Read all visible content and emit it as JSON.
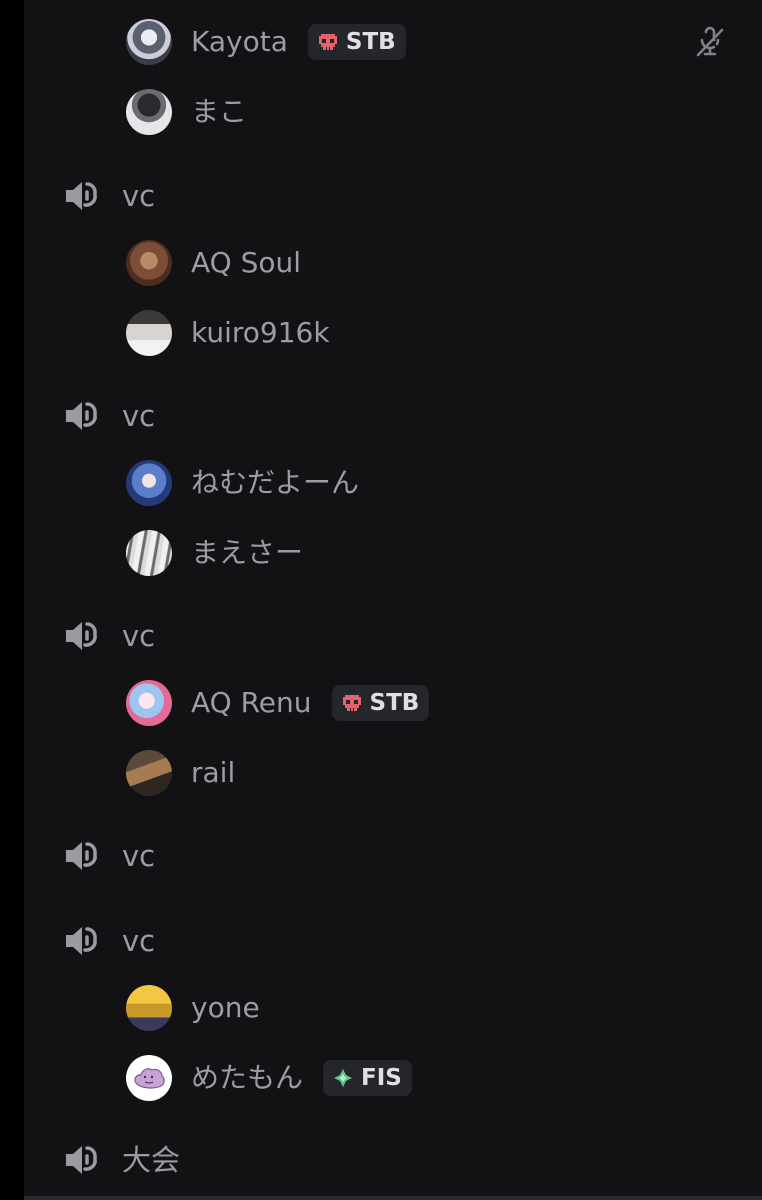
{
  "colors": {
    "background": "#121214",
    "text": "#9b9ca4",
    "tag_bg": "#25262b",
    "tag_text": "#dfe0e5",
    "stb_icon": "#e5626c",
    "fis_icon": "#5fc38a"
  },
  "top_members": [
    {
      "name": "Kayota",
      "tag": "STB",
      "tag_icon": "skull-icon",
      "muted": true
    },
    {
      "name": "まこ"
    }
  ],
  "channels": [
    {
      "name": "vc",
      "icon": "speaker-icon",
      "members": [
        {
          "name": "AQ Soul"
        },
        {
          "name": "kuiro916k"
        }
      ]
    },
    {
      "name": "vc",
      "icon": "speaker-icon",
      "members": [
        {
          "name": "ねむだよーん"
        },
        {
          "name": "まえさー"
        }
      ]
    },
    {
      "name": "vc",
      "icon": "speaker-icon",
      "members": [
        {
          "name": "AQ Renu",
          "tag": "STB",
          "tag_icon": "skull-icon"
        },
        {
          "name": "rail"
        }
      ]
    },
    {
      "name": "vc",
      "icon": "speaker-icon",
      "members": []
    },
    {
      "name": "vc",
      "icon": "speaker-icon",
      "members": [
        {
          "name": "yone"
        },
        {
          "name": "めたもん",
          "tag": "FIS",
          "tag_icon": "diamond-sparkle-icon"
        }
      ]
    },
    {
      "name": "大会",
      "icon": "speaker-icon",
      "members": []
    }
  ]
}
